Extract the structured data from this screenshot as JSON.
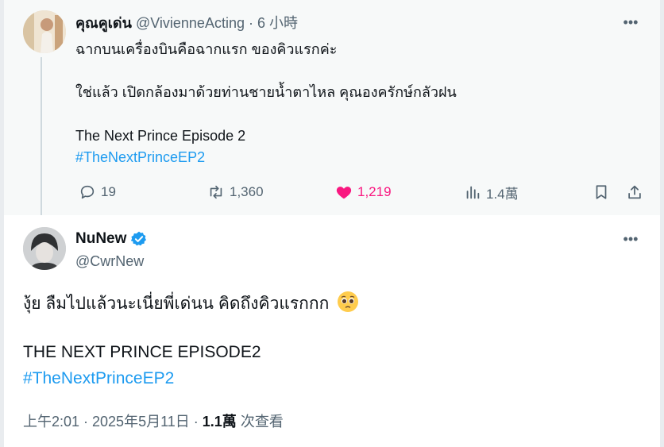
{
  "parent_tweet": {
    "author_name": "คุณคูเด่น",
    "handle": "@VivienneActing",
    "separator": "·",
    "time": "6 小時",
    "lines": [
      "ฉากบนเครื่องบินคือฉากแรก ของคิวแรกค่ะ",
      "ใช่แล้ว เปิดกล้องมาด้วยท่านชายน้ำตาไหล คุณองครักษ์กลัวฝน",
      "The Next Prince Episode 2"
    ],
    "hashtag": "#TheNextPrinceEP2",
    "actions": {
      "replies": "19",
      "retweets": "1,360",
      "likes": "1,219",
      "views": "1.4萬"
    }
  },
  "main_tweet": {
    "author_name": "NuNew",
    "handle": "@CwrNew",
    "text_line_1": "งุ้ย ลืมไปแล้วนะเนี่ยพี่เด่นน คิดถึงคิวแรกกก",
    "emoji": "🥺",
    "text_line_2": "THE NEXT PRINCE EPISODE2",
    "hashtag": "#TheNextPrinceEP2",
    "timestamp": "上午2:01 · 2025年5月11日 ·",
    "view_count": "1.1萬",
    "view_label": "次查看"
  },
  "colors": {
    "accent": "#1d9bf0",
    "like": "#f91880",
    "muted": "#536471",
    "verified": "#1d9bf0"
  }
}
